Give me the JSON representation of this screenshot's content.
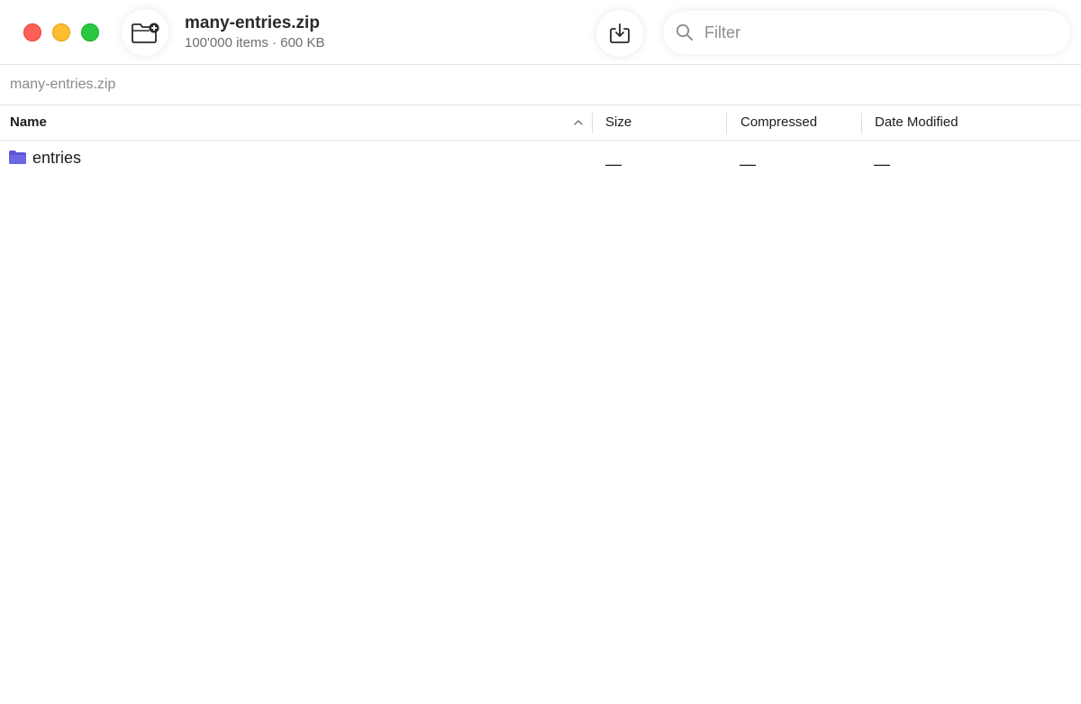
{
  "window": {
    "title": "many-entries.zip",
    "subtitle": "100'000 items · 600 KB"
  },
  "toolbar": {
    "add_icon": "folder-add-icon",
    "extract_icon": "extract-download-icon",
    "filter_placeholder": "Filter",
    "filter_value": ""
  },
  "pathbar": {
    "path": "many-entries.zip"
  },
  "table": {
    "columns": {
      "name": "Name",
      "size": "Size",
      "compressed": "Compressed",
      "date_modified": "Date Modified"
    },
    "sort_indicator": "chevron-up-icon",
    "rows": [
      {
        "name": "entries",
        "icon": "folder-icon",
        "size": "—",
        "compressed": "—",
        "date_modified": "—"
      }
    ]
  },
  "colors": {
    "close": "#fe5f57",
    "minimize": "#febc2e",
    "zoom": "#28c840",
    "folder": "#5b55d6"
  }
}
